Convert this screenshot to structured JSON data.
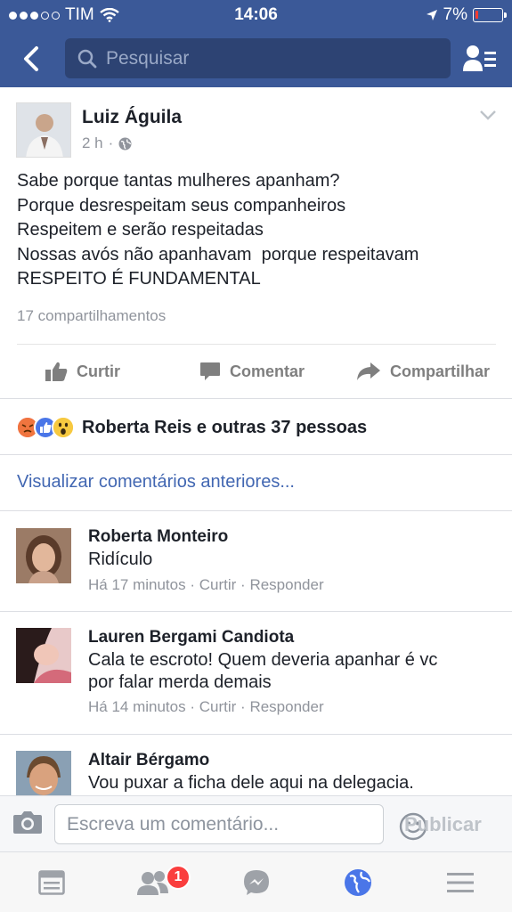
{
  "status_bar": {
    "carrier": "TIM",
    "time": "14:06",
    "battery": "7%",
    "battery_level": 0.07
  },
  "header": {
    "search_placeholder": "Pesquisar",
    "back_icon": "back-chevron-icon",
    "friends_icon": "friend-list-icon"
  },
  "post": {
    "author": "Luiz Águila",
    "time": "2 h",
    "privacy_icon": "globe-icon",
    "text_lines": [
      "Sabe porque tantas mulheres apanham?",
      "Porque desrespeitam seus companheiros",
      "Respeitem e serão respeitadas",
      "Nossas avós não apanhavam  porque respeitavam",
      "RESPEITO É FUNDAMENTAL"
    ],
    "shares": "17 compartilhamentos",
    "actions": {
      "like": "Curtir",
      "comment": "Comentar",
      "share": "Compartilhar"
    },
    "reactions_text": "Roberta Reis e outras 37 pessoas",
    "view_previous": "Visualizar comentários anteriores..."
  },
  "comments": [
    {
      "name": "Roberta Monteiro",
      "text_lines": [
        "Ridículo"
      ],
      "time": "Há 17 minutos",
      "like": "Curtir",
      "reply": "Responder"
    },
    {
      "name": "Lauren Bergami Candiota",
      "text_lines": [
        "Cala te escroto! Quem deveria apanhar é vc",
        "por falar merda demais"
      ],
      "time": "Há 14 minutos",
      "like": "Curtir",
      "reply": "Responder"
    },
    {
      "name": "Altair Bérgamo",
      "text_lines": [
        "Vou puxar a ficha dele aqui na delegacia."
      ],
      "time": "",
      "like": "",
      "reply": ""
    }
  ],
  "composer": {
    "placeholder": "Escreva um comentário...",
    "publish": "Publicar"
  },
  "tabbar": {
    "badge": "1"
  },
  "colors": {
    "brand": "#3b5998",
    "link": "#4267b2",
    "muted": "#90949c"
  }
}
